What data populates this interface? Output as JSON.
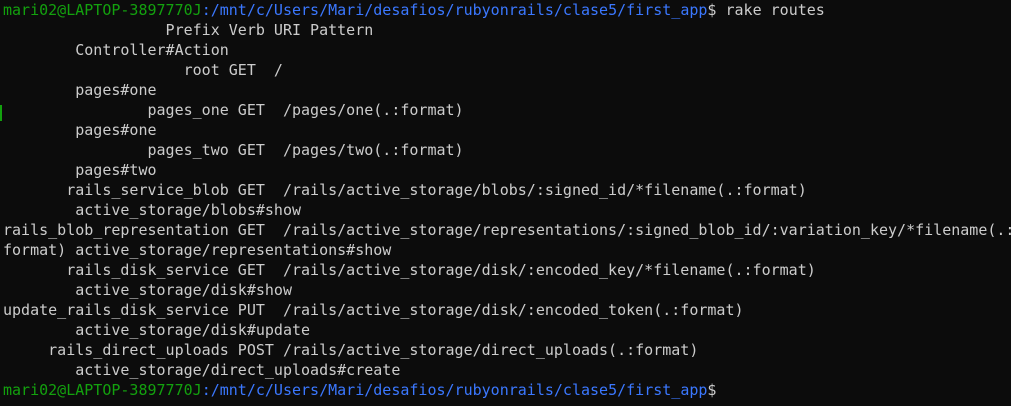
{
  "prompt": {
    "user_host": "mari02@LAPTOP-3897770J",
    "path": ":/mnt/c/Users/Mari/desafios/rubyonrails/clase5/first_app",
    "symbol": "$",
    "command": " rake routes"
  },
  "output_lines": [
    "                  Prefix Verb URI Pattern",
    "        Controller#Action",
    "                    root GET  /",
    "        pages#one",
    "                pages_one GET  /pages/one(.:format)",
    "        pages#one",
    "                pages_two GET  /pages/two(.:format)",
    "        pages#two",
    "       rails_service_blob GET  /rails/active_storage/blobs/:signed_id/*filename(.:format)",
    "        active_storage/blobs#show",
    "rails_blob_representation GET  /rails/active_storage/representations/:signed_blob_id/:variation_key/*filename(.:",
    "format) active_storage/representations#show",
    "       rails_disk_service GET  /rails/active_storage/disk/:encoded_key/*filename(.:format)",
    "        active_storage/disk#show",
    "update_rails_disk_service PUT  /rails/active_storage/disk/:encoded_token(.:format)",
    "        active_storage/disk#update",
    "     rails_direct_uploads POST /rails/active_storage/direct_uploads(.:format)",
    "        active_storage/direct_uploads#create"
  ],
  "final_prompt": {
    "user_host": "mari02@LAPTOP-3897770J",
    "path": ":/mnt/c/Users/Mari/desafios/rubyonrails/clase5/first_app",
    "symbol": "$"
  },
  "colors": {
    "background": "#0c0c0c",
    "text": "#cccccc",
    "user_host": "#13a10e",
    "path": "#3b78ff"
  }
}
